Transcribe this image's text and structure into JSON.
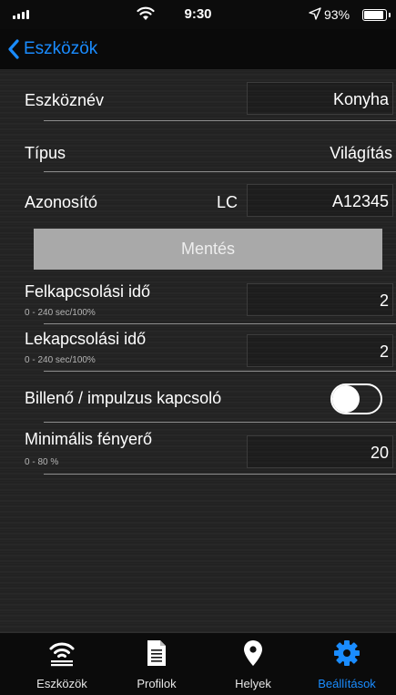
{
  "status_bar": {
    "time": "9:30",
    "battery_text": "93%",
    "battery_level": 0.93
  },
  "nav": {
    "back_label": "Eszközök"
  },
  "form": {
    "device_name": {
      "label": "Eszköznév",
      "value": "Konyha"
    },
    "type": {
      "label": "Típus",
      "value": "Világítás"
    },
    "identifier": {
      "label": "Azonosító",
      "prefix": "LC",
      "value": "A12345"
    },
    "save_label": "Mentés",
    "on_time": {
      "label": "Felkapcsolási idő",
      "hint": "0 - 240 sec/100%",
      "value": "2"
    },
    "off_time": {
      "label": "Lekapcsolási idő",
      "hint": "0 - 240 sec/100%",
      "value": "2"
    },
    "toggle_switch": {
      "label": "Billenő / impulzus kapcsoló",
      "on": false
    },
    "min_brightness": {
      "label": "Minimális fényerő",
      "hint": "0 - 80 %",
      "value": "20"
    }
  },
  "tabs": [
    {
      "label": "Eszközök",
      "icon": "wifi-icon",
      "active": false
    },
    {
      "label": "Profilok",
      "icon": "document-icon",
      "active": false
    },
    {
      "label": "Helyek",
      "icon": "map-pin-icon",
      "active": false
    },
    {
      "label": "Beállítások",
      "icon": "gear-icon",
      "active": true
    }
  ],
  "colors": {
    "accent": "#1a8cff",
    "save_button_bg": "#a9a9a9"
  }
}
